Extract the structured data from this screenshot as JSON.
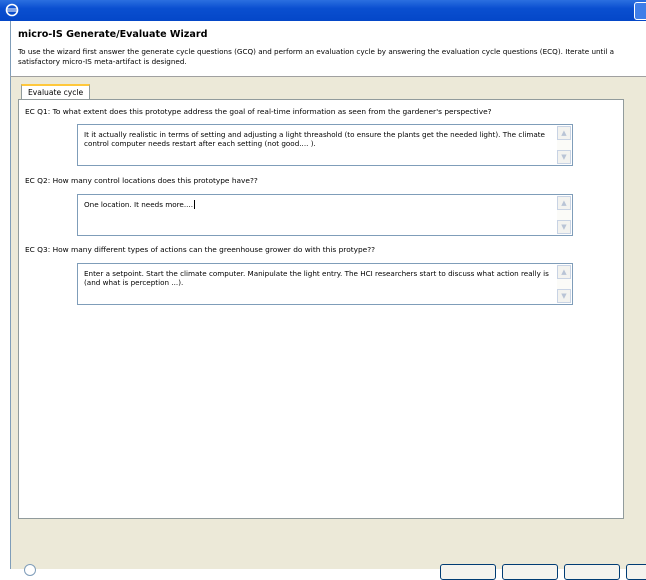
{
  "window": {
    "app_icon": "eclipse-icon"
  },
  "wizard": {
    "title": "micro-IS Generate/Evaluate Wizard",
    "description": "To use the wizard first answer the generate cycle questions (GCQ) and perform an evaluation cycle by answering the evaluation cycle questions (ECQ). Iterate until a satisfactory micro-IS meta-artifact is designed."
  },
  "tabs": [
    {
      "label": "Evaluate cycle",
      "selected": true
    }
  ],
  "questions": [
    {
      "id": "EC Q1:",
      "text": "To what extent does this prototype address the goal of real-time information as seen from the gardener's perspective?",
      "answer": "It it actually realistic in terms of setting and adjusting a light threashold (to ensure the plants get the needed light). The climate control computer needs restart after each setting (not good.... )."
    },
    {
      "id": "EC Q2:",
      "text": "How many control locations does this prototype have??",
      "answer": "One location. It needs more...."
    },
    {
      "id": "EC Q3:",
      "text": "How many different types of actions can the greenhouse grower do with this protype??",
      "answer": "Enter a setpoint. Start the climate computer. Manipulate the light entry. The HCI researchers start to discuss what action really is (and what is perception ...)."
    }
  ],
  "colors": {
    "title_bar": "#0a4fd0",
    "dialog_bg": "#ece9d8",
    "tab_highlight": "#ffc83c",
    "field_border": "#7f9db9"
  }
}
